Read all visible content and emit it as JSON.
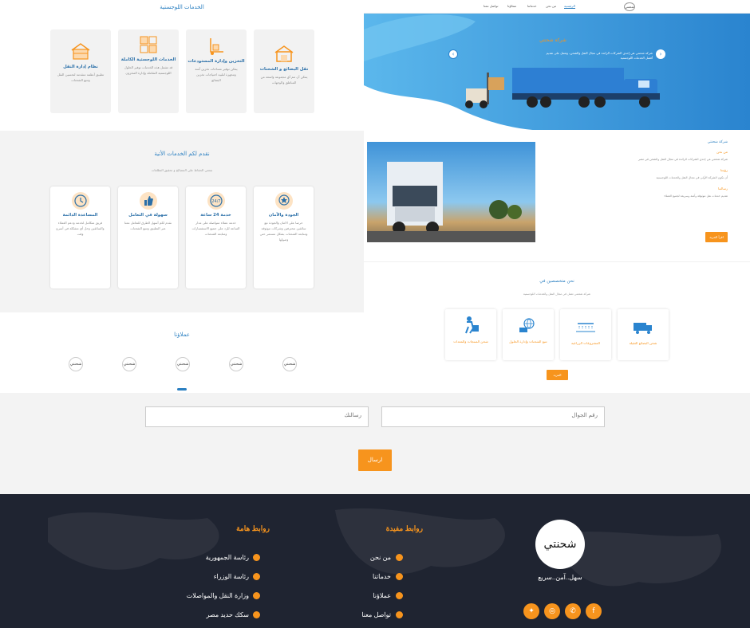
{
  "left": {
    "logistics_title": "الخدمات اللوجستية",
    "logistics_cards": [
      {
        "title": "نقل البضائع و الشحنات",
        "desc": "يمكن أن تتم أي مجموعة واسعة من المناطق والوجهات"
      },
      {
        "title": "التخزين وإدارة المستودعات",
        "desc": "يمكن توفير مساحات تخزين آمنة ومجهزة لتلبية احتياجات تخزين البضائع"
      },
      {
        "title": "الخدمات اللوجستية الكاملة",
        "desc": "قد تشمل هذه الخدمات توفير الحلول اللوجستية الشاملة وإدارة المخزون"
      },
      {
        "title": "نظام إدارة النقل",
        "desc": "تطبيق أنظمة متقدمة لتحسين النقل وتتبع الشحنات"
      }
    ],
    "services_title": "نقدم لكم الخدمات الأتية",
    "services_sub": "سعتي الحفاظ علي المصالح و تحقيق التطلعات",
    "service_cards": [
      {
        "title": "الجودة والأمان",
        "desc": "حرصا على الامان والجودة مع سائقين محترفين وشركات موثوقة ومتابعة الشحنات بشكل مستمر حتى وصولها"
      },
      {
        "title": "خدمة 24 ساعة",
        "desc": "خدمة عملاء متواصلة على مدار الساعة للرد على جميع الاستفسارات ومتابعة الشحنات"
      },
      {
        "title": "سهولة في التعامل",
        "desc": "نقدم لكم أسهل الطرق للتعامل معنا عبر التطبيق وتتبع الشحنات"
      },
      {
        "title": "المساعدة الدائمة",
        "desc": "فريق متكامل لخدمة ودعم العملاء والسائقين وحل أي مشكلة في أسرع وقت"
      }
    ],
    "clients_title": "عملاؤنا",
    "client_logo": "شحنتي"
  },
  "right": {
    "nav": [
      "الرئيسية",
      "من نحن",
      "خدماتنا",
      "عملاؤنا",
      "تواصل معنا"
    ],
    "logo": "شحنتي",
    "hero_title": "شركة شحنتي",
    "hero_text": "شركة شحنتي هي إحدى الشركات الرائدة في مجال النقل والشحن، وتعمل على تقديم أفضل الخدمات اللوجستية",
    "about_heading": "شركة شحنتي",
    "about_sections": [
      {
        "title": "من نحن",
        "text": "شركة شحنتي هي إحدى الشركات الرائدة في مجال النقل والشحن في مصر"
      },
      {
        "title": "رؤيتنا",
        "text": "أن نكون الشركة الأولى في مجال النقل والخدمات اللوجستية"
      },
      {
        "title": "رسالتنا",
        "text": "تقديم خدمات نقل موثوقة وآمنة وسريعة لجميع العملاء"
      }
    ],
    "read_more": "اقرأ المزيد",
    "specialists_title": "نحن متخصصين في",
    "specialists_sub": "شركة شحنتي تعمل في مجال النقل والخدمات اللوجستية",
    "specialist_cards": [
      {
        "title": "شحن البضائع الثقيلة"
      },
      {
        "title": "المشروعات الزراعية"
      },
      {
        "title": "تتبع الشحنات وإدارة الحلول"
      },
      {
        "title": "شحن المنتجات والمعدات"
      }
    ],
    "more_button": "المزيد"
  },
  "form": {
    "phone_placeholder": "رقم الجوال",
    "message_placeholder": "رسالتك",
    "send_label": "ارسال"
  },
  "footer": {
    "logo": "شحنتي",
    "tagline": "سهل..آمن..سريع",
    "useful_title": "روابط مفيدة",
    "useful_links": [
      "من نحن",
      "خدماتنا",
      "عملاؤنا",
      "تواصل معنا"
    ],
    "important_title": "روابط هامة",
    "important_links": [
      "رئاسة الجمهورية",
      "رئاسة الوزراء",
      "وزارة النقل والمواصلات",
      "سكك حديد مصر"
    ],
    "social_icons": [
      "facebook-icon",
      "whatsapp-icon",
      "instagram-icon",
      "twitter-icon"
    ],
    "accent_color": "#f7941d",
    "footer_bg": "#1f2431"
  }
}
